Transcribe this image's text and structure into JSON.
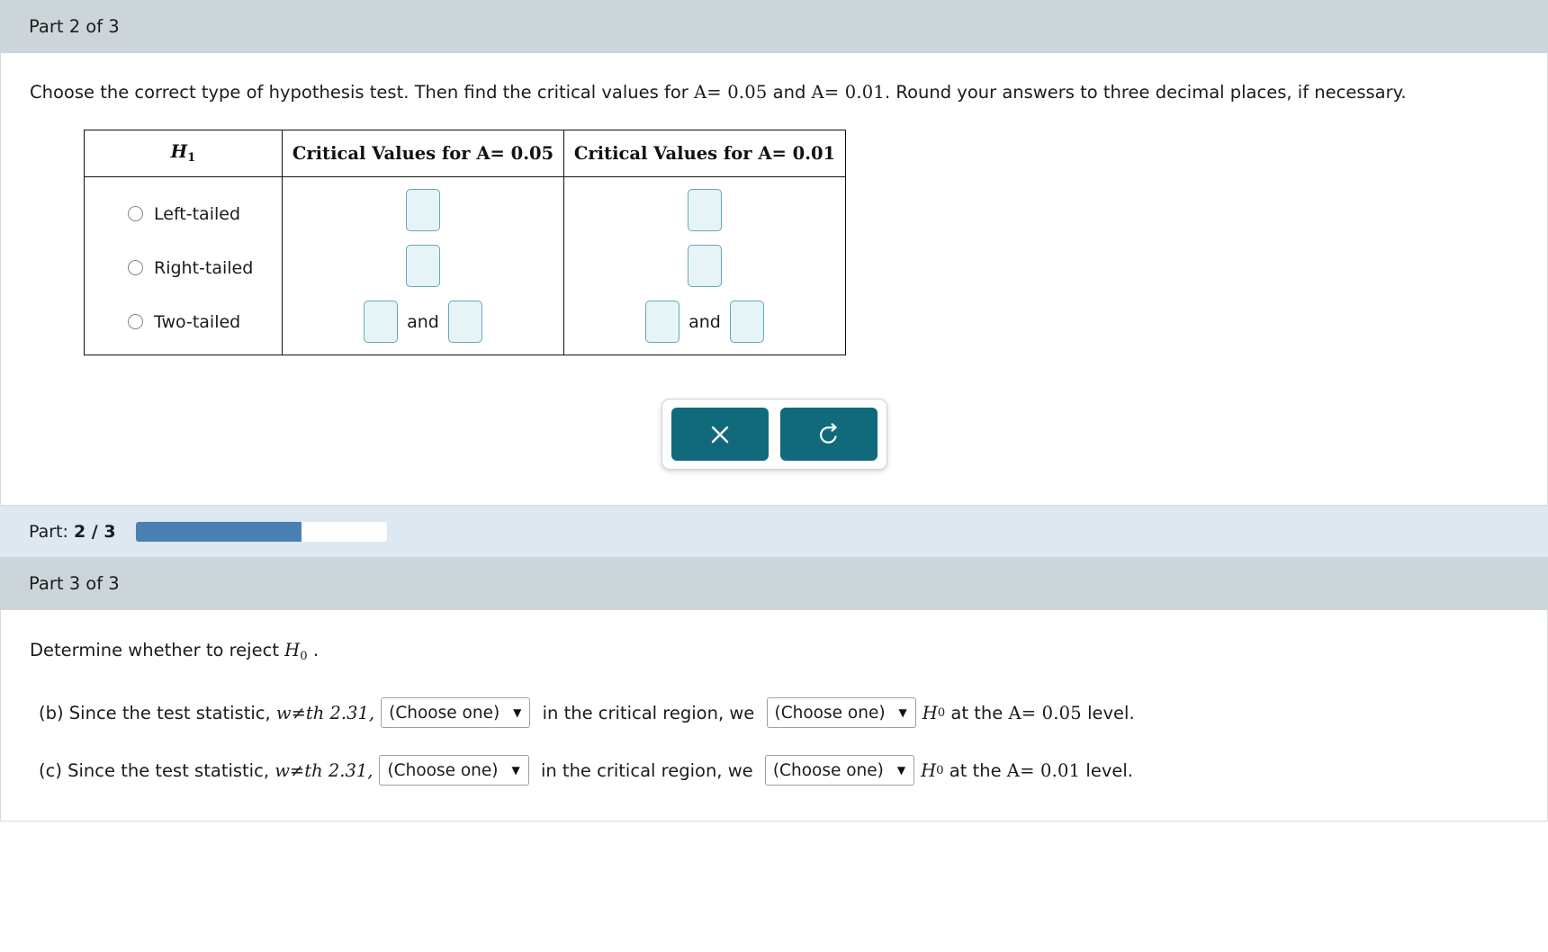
{
  "part2": {
    "header": "Part 2 of 3",
    "question": {
      "lead": "Choose the correct type of hypothesis test. Then find the critical values for ",
      "alpha1": "A= 0.05",
      "mid": " and ",
      "alpha2": "A= 0.01",
      "tail": ". Round your answers to three decimal places, if necessary."
    },
    "table": {
      "headers": {
        "h1": "H",
        "h1_sub": "1",
        "col_005": "Critical Values for A= 0.05",
        "col_001": "Critical Values for A= 0.01"
      },
      "rows": [
        {
          "label": "Left-tailed",
          "type": "single"
        },
        {
          "label": "Right-tailed",
          "type": "single"
        },
        {
          "label": "Two-tailed",
          "type": "pair",
          "joiner": "and"
        }
      ]
    },
    "actions": {
      "clear_label": "×",
      "reset_label": "↺"
    }
  },
  "progress": {
    "label_prefix": "Part: ",
    "current": "2",
    "separator": " / ",
    "total": "3",
    "percent": 66,
    "fill_color": "#4a7fb4",
    "track_color": "#ffffff"
  },
  "part3": {
    "header": "Part 3 of 3",
    "determine": {
      "text": "Determine whether to reject ",
      "symbol": "H",
      "symbol_sub": "0",
      "period": " ."
    },
    "statements": [
      {
        "marker": "(b) ",
        "pre": "Since the test statistic, ",
        "math": "w≠th 2.31,",
        "select1": "(Choose one)",
        "mid": " in the critical region, we ",
        "select2": "(Choose one)",
        "symbol": "H",
        "symbol_sub": "0",
        "post_pre": " at the ",
        "alpha": "A= 0.05",
        "post": " level."
      },
      {
        "marker": "(c) ",
        "pre": "Since the test statistic, ",
        "math": "w≠th 2.31,",
        "select1": "(Choose one)",
        "mid": " in the critical region, we ",
        "select2": "(Choose one)",
        "symbol": "H",
        "symbol_sub": "0",
        "post_pre": " at the ",
        "alpha": "A= 0.01",
        "post": " level."
      }
    ],
    "caret_glyph": "▼"
  },
  "colors": {
    "header_bar": "#ccd6da",
    "input_fill": "#e6f4f8",
    "input_border": "#64a8b8",
    "teal_button": "#106a7c",
    "progress_strip": "#dde8f1"
  }
}
